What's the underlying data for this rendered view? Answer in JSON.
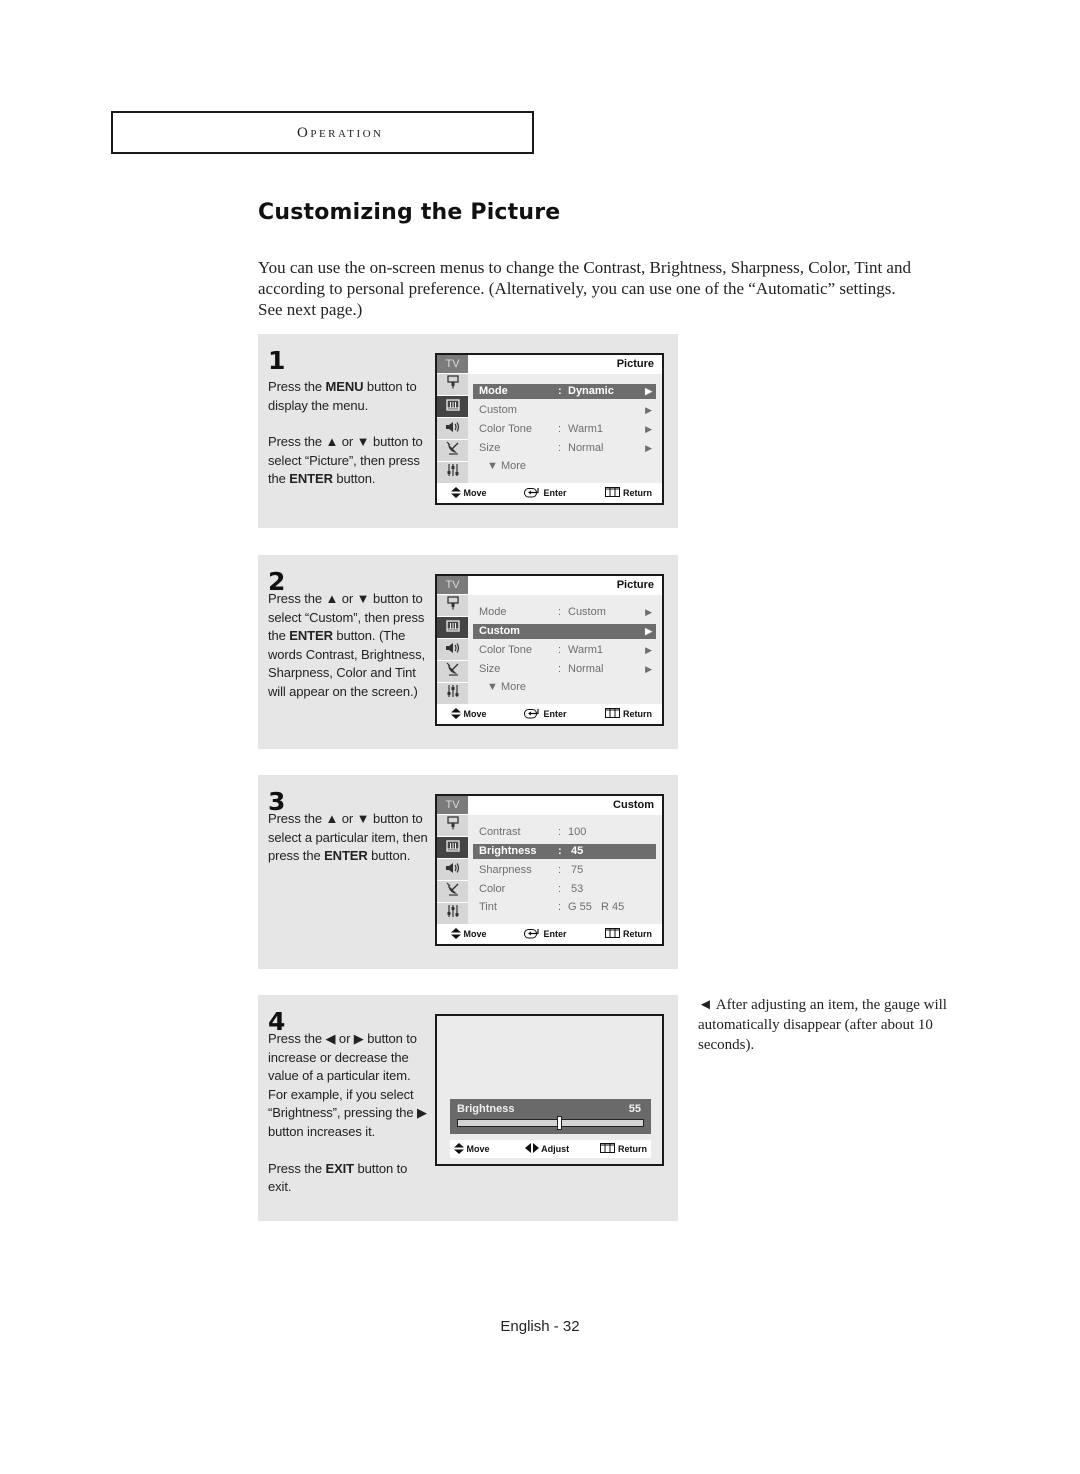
{
  "section": {
    "label": "Operation"
  },
  "page_title": "Customizing the Picture",
  "intro": "You can use the on-screen menus to change the Contrast, Brightness, Sharpness, Color, Tint and  according to personal preference. (Alternatively, you can use one of the “Automatic” settings. See next page.)",
  "osd_common": {
    "tv_label": "TV",
    "footer": {
      "move": "Move",
      "enter": "Enter",
      "return": "Return",
      "adjust": "Adjust"
    },
    "icons": [
      "input-icon",
      "picture-icon",
      "sound-icon",
      "channel-icon",
      "setup-icon"
    ]
  },
  "steps": [
    {
      "number": "1",
      "text_parts": [
        [
          "Press the ",
          "MENU",
          " button to display the menu."
        ],
        [
          "Press the ▲ or ▼ button to select “Picture”, then press the ",
          "ENTER",
          " button."
        ]
      ],
      "osd": {
        "title": "Picture",
        "rows": [
          {
            "label": "Mode",
            "value": "Dynamic",
            "arrow": true,
            "selected": true
          },
          {
            "label": "Custom",
            "value": "",
            "arrow": true,
            "selected": false
          },
          {
            "label": "Color Tone",
            "value": "Warm1",
            "arrow": true,
            "selected": false
          },
          {
            "label": "Size",
            "value": "Normal",
            "arrow": true,
            "selected": false
          },
          {
            "label": "▼ More",
            "value": "",
            "arrow": false,
            "selected": false
          }
        ]
      }
    },
    {
      "number": "2",
      "text_parts": [
        [
          "Press the ▲ or ▼ button to select “Custom”, then press the ",
          "ENTER",
          " button. (The words Contrast, Brightness, Sharpness, Color and Tint will appear on the screen.)"
        ]
      ],
      "osd": {
        "title": "Picture",
        "rows": [
          {
            "label": "Mode",
            "value": "Custom",
            "arrow": true,
            "selected": false
          },
          {
            "label": "Custom",
            "value": "",
            "arrow": true,
            "selected": true
          },
          {
            "label": "Color Tone",
            "value": "Warm1",
            "arrow": true,
            "selected": false
          },
          {
            "label": "Size",
            "value": "Normal",
            "arrow": true,
            "selected": false
          },
          {
            "label": "▼ More",
            "value": "",
            "arrow": false,
            "selected": false
          }
        ]
      }
    },
    {
      "number": "3",
      "text_parts": [
        [
          "Press the ▲ or ▼ button to select a particular item, then press the ",
          "ENTER",
          " button."
        ]
      ],
      "osd": {
        "title": "Custom",
        "rows": [
          {
            "label": "Contrast",
            "value": "100",
            "arrow": false,
            "selected": false
          },
          {
            "label": "Brightness",
            "value": " 45",
            "arrow": false,
            "selected": true
          },
          {
            "label": "Sharpness",
            "value": " 75",
            "arrow": false,
            "selected": false
          },
          {
            "label": "Color",
            "value": " 53",
            "arrow": false,
            "selected": false
          },
          {
            "label": "Tint",
            "value": "G 55   R 45",
            "arrow": false,
            "selected": false
          }
        ]
      }
    },
    {
      "number": "4",
      "text_parts": [
        [
          "Press the ◀ or ▶ button to increase or decrease the value of a particular item."
        ],
        [
          "For example, if you select “Brightness”, pressing the ▶ button increases it."
        ],
        [
          "Press the ",
          "EXIT",
          " button to exit."
        ]
      ],
      "gauge": {
        "label": "Brightness",
        "value": "55",
        "fraction": 0.55
      }
    }
  ],
  "side_note": "◄  After adjusting an item, the gauge will automatically disappear (after about 10 seconds).",
  "footer": "English - 32"
}
